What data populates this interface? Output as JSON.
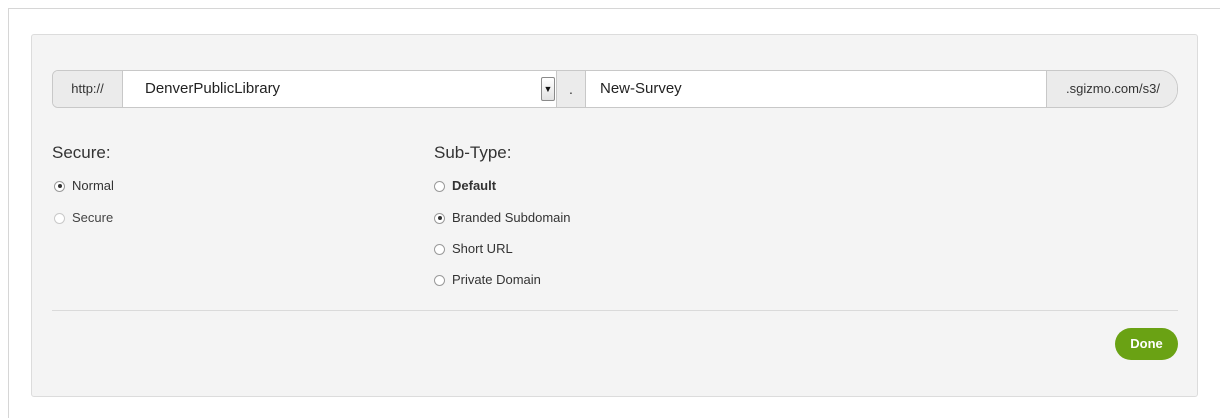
{
  "url_builder": {
    "protocol": "http://",
    "domain_value": "DenverPublicLibrary",
    "separator": ".",
    "path_value": "New-Survey",
    "suffix": ".sgizmo.com/s3/",
    "dropdown_icon": "triangle-down"
  },
  "secure": {
    "heading": "Secure:",
    "options": [
      {
        "label": "Normal",
        "selected": true
      },
      {
        "label": "Secure",
        "selected": false
      }
    ]
  },
  "subtype": {
    "heading": "Sub-Type:",
    "options": [
      {
        "label": "Default",
        "selected": false
      },
      {
        "label": "Branded Subdomain",
        "selected": true
      },
      {
        "label": "Short URL",
        "selected": false
      },
      {
        "label": "Private Domain",
        "selected": false
      }
    ]
  },
  "actions": {
    "done_label": "Done",
    "done_color": "#6aa214"
  }
}
